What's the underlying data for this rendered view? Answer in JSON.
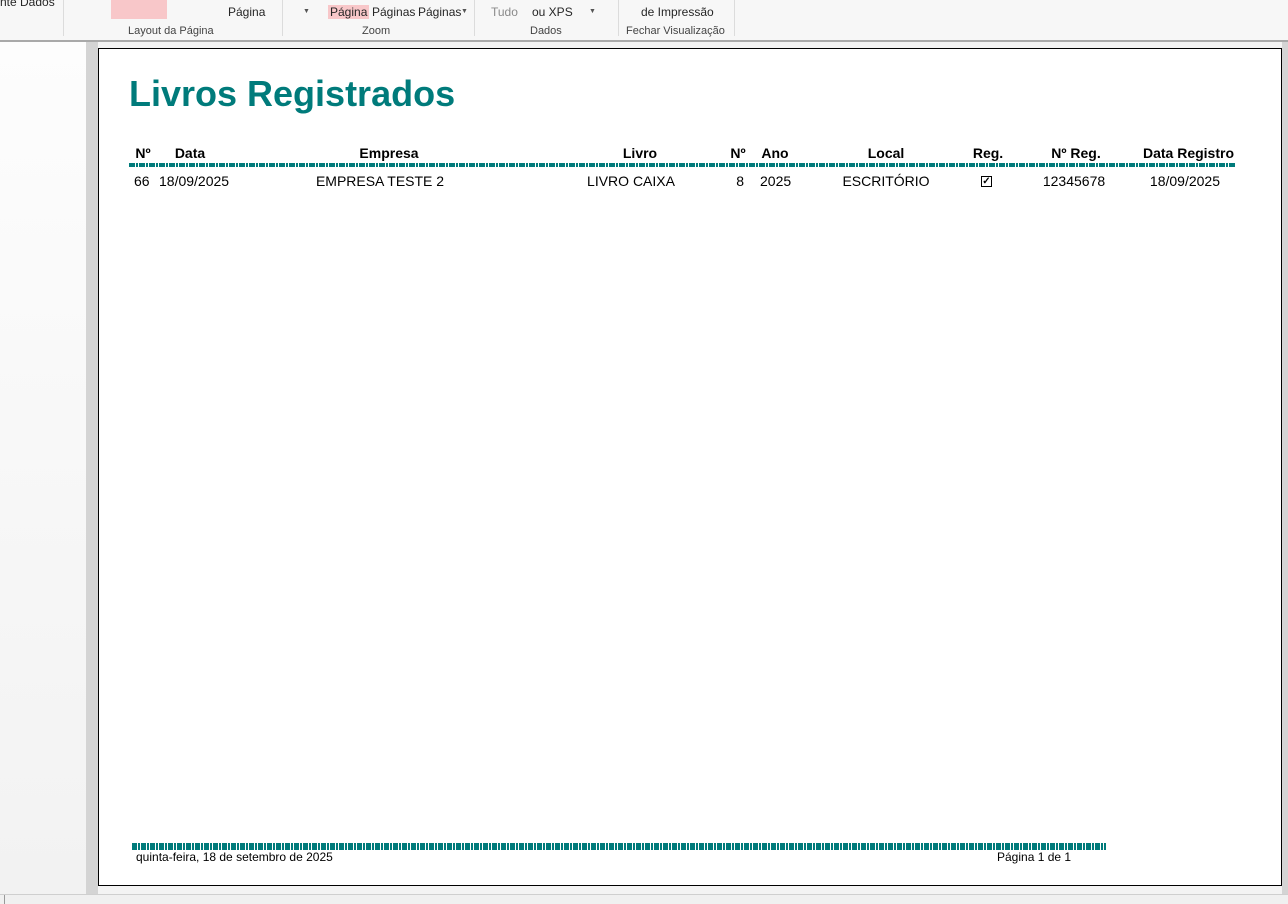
{
  "ribbon": {
    "partial_left": "nte Dados",
    "layout_btn_label": "Página",
    "group_layout": "Layout da Página",
    "zoom_page": "Página",
    "zoom_two_pages": "Páginas",
    "zoom_more_pages": "Páginas",
    "group_zoom": "Zoom",
    "data_all": "Tudo",
    "data_pdf_xps": "ou XPS",
    "group_data": "Dados",
    "close_label": "de Impressão",
    "group_close": "Fechar Visualização"
  },
  "report": {
    "title": "Livros Registrados",
    "columns": [
      "Nº",
      "Data",
      "Empresa",
      "Livro",
      "Nº",
      "Ano",
      "Local",
      "Reg.",
      "Nº Reg.",
      "Data Registro"
    ],
    "rows": [
      {
        "num": "66",
        "date": "18/09/2025",
        "company": "EMPRESA TESTE 2",
        "book": "LIVRO CAIXA",
        "book_num": "8",
        "year": "2025",
        "location": "ESCRITÓRIO",
        "registered": true,
        "reg_num": "12345678",
        "reg_date": "18/09/2025"
      }
    ],
    "footer_date": "quinta-feira, 18 de setembro de 2025",
    "footer_page": "Página 1 de 1"
  },
  "colors": {
    "accent": "#007b7b",
    "highlight": "#f8c7c9"
  }
}
